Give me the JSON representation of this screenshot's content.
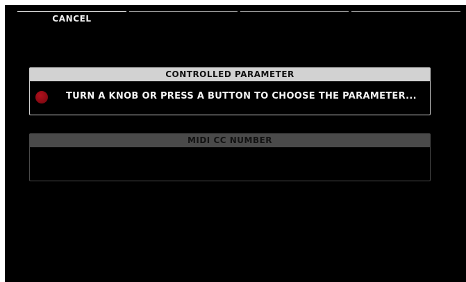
{
  "softkeys": [
    {
      "label": "CANCEL"
    },
    {
      "label": ""
    },
    {
      "label": ""
    },
    {
      "label": ""
    }
  ],
  "controlled_parameter": {
    "title": "CONTROLLED PARAMETER",
    "message": "TURN A KNOB OR PRESS A BUTTON TO CHOOSE THE PARAMETER...",
    "indicator_icon": "record-dot-icon",
    "indicator_color": "#9b0d18"
  },
  "midi_cc": {
    "title": "MIDI CC NUMBER",
    "value": ""
  },
  "colors": {
    "background": "#000000",
    "active_header": "#d2d2d2",
    "inactive_header": "#4a4a4a"
  }
}
